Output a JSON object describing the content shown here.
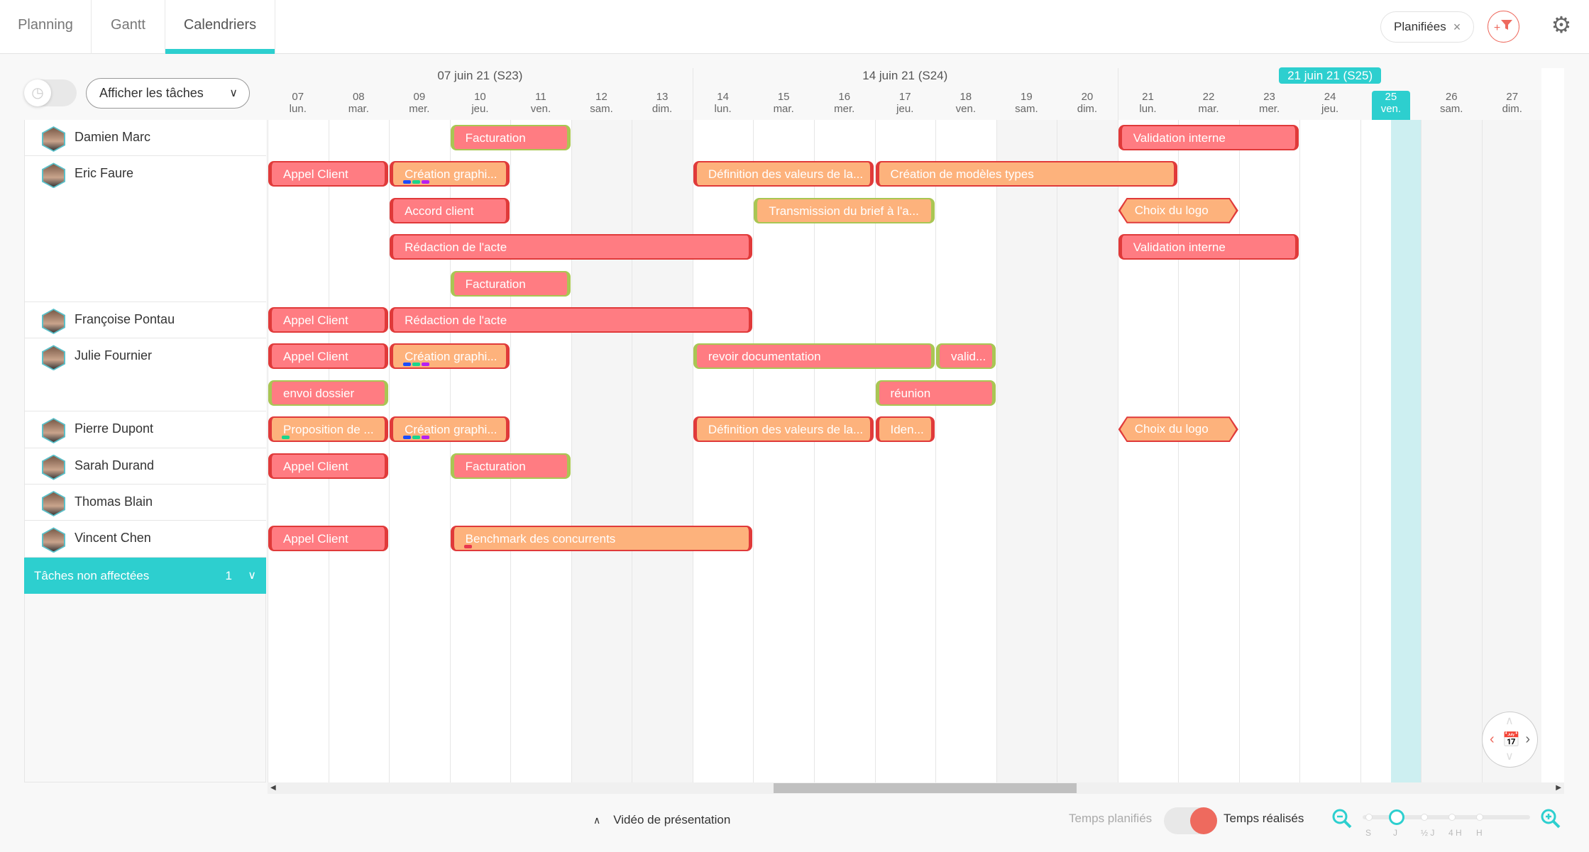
{
  "tabs": [
    {
      "label": "Planning",
      "active": false
    },
    {
      "label": "Gantt",
      "active": false
    },
    {
      "label": "Calendriers",
      "active": true
    }
  ],
  "filter_chip": {
    "label": "Planifiées",
    "close": "×"
  },
  "icons": {
    "add_filter": "add-filter-icon",
    "settings": "gear-icon",
    "clock": "clock-icon"
  },
  "toolbar": {
    "task_select": "Afficher les tâches",
    "clock_toggle_on": false
  },
  "weeks": [
    {
      "label": "07 juin 21 (S23)",
      "current": false
    },
    {
      "label": "14 juin 21 (S24)",
      "current": false
    },
    {
      "label": "21 juin 21 (S25)",
      "current": true
    }
  ],
  "days": [
    {
      "num": "07",
      "dow": "lun."
    },
    {
      "num": "08",
      "dow": "mar."
    },
    {
      "num": "09",
      "dow": "mer."
    },
    {
      "num": "10",
      "dow": "jeu."
    },
    {
      "num": "11",
      "dow": "ven."
    },
    {
      "num": "12",
      "dow": "sam."
    },
    {
      "num": "13",
      "dow": "dim."
    },
    {
      "num": "14",
      "dow": "lun."
    },
    {
      "num": "15",
      "dow": "mar."
    },
    {
      "num": "16",
      "dow": "mer."
    },
    {
      "num": "17",
      "dow": "jeu."
    },
    {
      "num": "18",
      "dow": "ven."
    },
    {
      "num": "19",
      "dow": "sam."
    },
    {
      "num": "20",
      "dow": "dim."
    },
    {
      "num": "21",
      "dow": "lun."
    },
    {
      "num": "22",
      "dow": "mar."
    },
    {
      "num": "23",
      "dow": "mer."
    },
    {
      "num": "24",
      "dow": "jeu."
    },
    {
      "num": "25",
      "dow": "ven."
    },
    {
      "num": "26",
      "dow": "sam."
    },
    {
      "num": "27",
      "dow": "dim."
    }
  ],
  "today_index": 18,
  "people": [
    {
      "name": "Damien Marc",
      "lanes": 1
    },
    {
      "name": "Eric Faure",
      "lanes": 4
    },
    {
      "name": "Françoise Pontau",
      "lanes": 1
    },
    {
      "name": "Julie Fournier",
      "lanes": 2
    },
    {
      "name": "Pierre Dupont",
      "lanes": 1
    },
    {
      "name": "Sarah Durand",
      "lanes": 1
    },
    {
      "name": "Thomas Blain",
      "lanes": 1
    },
    {
      "name": "Vincent Chen",
      "lanes": 1
    }
  ],
  "unassigned": {
    "label": "Tâches non affectées",
    "count": "1"
  },
  "tasks": [
    {
      "lane": 0,
      "start": 3,
      "end": 4,
      "label": "Facturation",
      "color": "red",
      "edge": "green"
    },
    {
      "lane": 0,
      "start": 14,
      "end": 16,
      "label": "Validation interne",
      "color": "red",
      "edge": "red"
    },
    {
      "lane": 1,
      "start": 0,
      "end": 1,
      "label": "Appel Client",
      "color": "red",
      "edge": "red"
    },
    {
      "lane": 1,
      "start": 2,
      "end": 3,
      "label": "Création graphi...",
      "color": "orange",
      "edge": "red",
      "dots": [
        "#1a4cff",
        "#19d68c",
        "#b620f2"
      ]
    },
    {
      "lane": 1,
      "start": 7,
      "end": 9,
      "label": "Définition des valeurs de la...",
      "color": "orange",
      "edge": "red"
    },
    {
      "lane": 1,
      "start": 10,
      "end": 14,
      "label": "Création de modèles types",
      "color": "orange",
      "edge": "red"
    },
    {
      "lane": 2,
      "start": 2,
      "end": 3,
      "label": "Accord client",
      "color": "red",
      "edge": "red"
    },
    {
      "lane": 2,
      "start": 8,
      "end": 10,
      "label": "Transmission du brief à l'a...",
      "color": "orange",
      "edge": "green"
    },
    {
      "lane": 2,
      "start": 14,
      "end": 15,
      "label": "Choix du logo",
      "color": "orange",
      "shape": "hex"
    },
    {
      "lane": 3,
      "start": 2,
      "end": 7,
      "label": "Rédaction de l'acte",
      "color": "red",
      "edge": "red"
    },
    {
      "lane": 3,
      "start": 14,
      "end": 16,
      "label": "Validation interne",
      "color": "red",
      "edge": "red"
    },
    {
      "lane": 4,
      "start": 3,
      "end": 4,
      "label": "Facturation",
      "color": "red",
      "edge": "green"
    },
    {
      "lane": 5,
      "start": 0,
      "end": 1,
      "label": "Appel Client",
      "color": "red",
      "edge": "red"
    },
    {
      "lane": 5,
      "start": 2,
      "end": 7,
      "label": "Rédaction de l'acte",
      "color": "red",
      "edge": "red"
    },
    {
      "lane": 6,
      "start": 0,
      "end": 1,
      "label": "Appel Client",
      "color": "red",
      "edge": "red"
    },
    {
      "lane": 6,
      "start": 2,
      "end": 3,
      "label": "Création graphi...",
      "color": "orange",
      "edge": "red",
      "dots": [
        "#1a4cff",
        "#19d68c",
        "#b620f2"
      ]
    },
    {
      "lane": 6,
      "start": 7,
      "end": 10,
      "label": "revoir documentation",
      "color": "red",
      "edge": "green"
    },
    {
      "lane": 6,
      "start": 11,
      "end": 11,
      "label": "valid...",
      "color": "red",
      "edge": "green"
    },
    {
      "lane": 7,
      "start": 0,
      "end": 1,
      "label": "envoi dossier",
      "color": "red",
      "edge": "green"
    },
    {
      "lane": 7,
      "start": 10,
      "end": 11,
      "label": "réunion",
      "color": "red",
      "edge": "green"
    },
    {
      "lane": 8,
      "start": 0,
      "end": 1,
      "label": "Proposition de ...",
      "color": "orange",
      "edge": "red",
      "dots": [
        "#19d68c"
      ]
    },
    {
      "lane": 8,
      "start": 2,
      "end": 3,
      "label": "Création graphi...",
      "color": "orange",
      "edge": "red",
      "dots": [
        "#1a4cff",
        "#19d68c",
        "#b620f2"
      ]
    },
    {
      "lane": 8,
      "start": 7,
      "end": 9,
      "label": "Définition des valeurs de la...",
      "color": "orange",
      "edge": "red"
    },
    {
      "lane": 8,
      "start": 10,
      "end": 10,
      "label": "Iden...",
      "color": "orange",
      "edge": "red"
    },
    {
      "lane": 8,
      "start": 14,
      "end": 15,
      "label": "Choix du logo",
      "color": "orange",
      "shape": "hex"
    },
    {
      "lane": 9,
      "start": 0,
      "end": 1,
      "label": "Appel Client",
      "color": "red",
      "edge": "red"
    },
    {
      "lane": 9,
      "start": 3,
      "end": 4,
      "label": "Facturation",
      "color": "red",
      "edge": "green"
    },
    {
      "lane": 11,
      "start": 0,
      "end": 1,
      "label": "Appel Client",
      "color": "red",
      "edge": "red"
    },
    {
      "lane": 11,
      "start": 3,
      "end": 7,
      "label": "Benchmark des concurrents",
      "color": "orange",
      "edge": "red",
      "dots": [
        "#e8384f"
      ]
    }
  ],
  "footer": {
    "video_label": "Vidéo de présentation",
    "planned_label": "Temps planifiés",
    "realized_label": "Temps réalisés",
    "toggle_realized": true,
    "zoom_levels": [
      "S",
      "J",
      "½ J",
      "4 H",
      "H"
    ],
    "zoom_selected": "J"
  },
  "colors": {
    "accent": "#2dcfcf",
    "task_red": "#ff7c82",
    "task_orange": "#fdb27c",
    "edge_red": "#e03a3a",
    "edge_green": "#a9c653",
    "filter": "#ee6a5e"
  }
}
